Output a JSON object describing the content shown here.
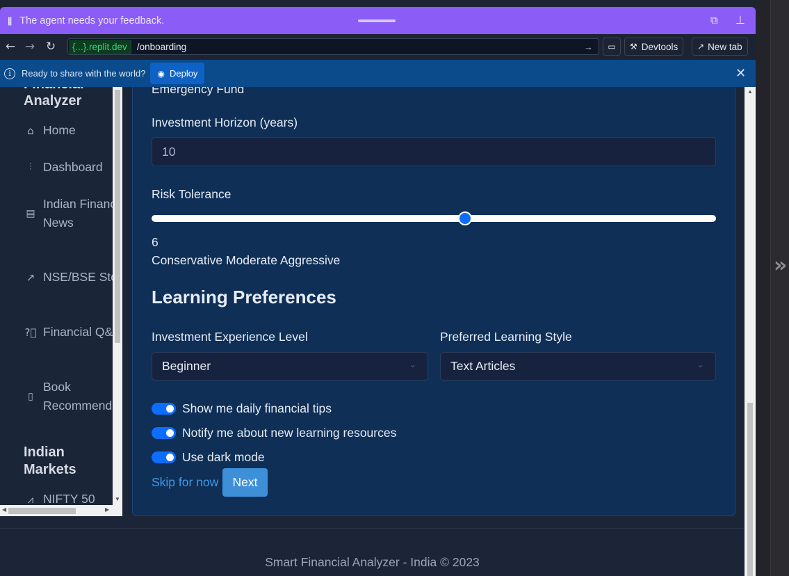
{
  "agent_bar": {
    "pause_icon": "pause-icon",
    "message": "The agent needs your feedback.",
    "icons": [
      "open-external-icon",
      "pin-icon"
    ]
  },
  "address_bar": {
    "domain": "{...}.replit.dev",
    "path": "/onboarding",
    "devtools_label": "Devtools",
    "new_tab_label": "New tab"
  },
  "deploy_bar": {
    "text": "Ready to share with the world?",
    "button_label": "Deploy"
  },
  "sidebar": {
    "brand_partial": "Financial",
    "brand_line2": "Analyzer",
    "items": [
      {
        "icon": "home-icon",
        "label": "Home"
      },
      {
        "icon": "bar-chart-icon",
        "label": "Dashboard"
      },
      {
        "icon": "document-icon",
        "label_line1": "Indian Financ",
        "label_line2": "News"
      },
      {
        "icon": "trending-up-icon",
        "label": "NSE/BSE Sto"
      },
      {
        "icon": "help-circle-icon",
        "label": "Financial Q&"
      },
      {
        "icon": "book-icon",
        "label_line1": "Book",
        "label_line2": "Recommenda"
      }
    ],
    "section2_line1": "Indian",
    "section2_line2": "Markets",
    "markets_item": {
      "icon": "activity-icon",
      "label": "NIFTY 50"
    }
  },
  "form": {
    "partial_label": "Emergency Fund",
    "horizon_label": "Investment Horizon (years)",
    "horizon_value": "10",
    "risk_label": "Risk Tolerance",
    "risk_value": "6",
    "risk_fraction": 0.555,
    "risk_scale_text": "Conservative Moderate Aggressive",
    "section_title": "Learning Preferences",
    "experience_label": "Investment Experience Level",
    "experience_value": "Beginner",
    "style_label": "Preferred Learning Style",
    "style_value": "Text Articles",
    "toggles": [
      {
        "label": "Show me daily financial tips",
        "on": true
      },
      {
        "label": "Notify me about new learning resources",
        "on": true
      },
      {
        "label": "Use dark mode",
        "on": true
      }
    ],
    "skip_label": "Skip for now",
    "next_label": "Next"
  },
  "footer": {
    "text": "Smart Financial Analyzer - India © 2023"
  },
  "colors": {
    "agent_bar": "#8b5cf6",
    "deploy_bar": "#0b4a8b",
    "card": "#0f2f57",
    "accent": "#0d6efd",
    "link": "#3d9ae8"
  }
}
